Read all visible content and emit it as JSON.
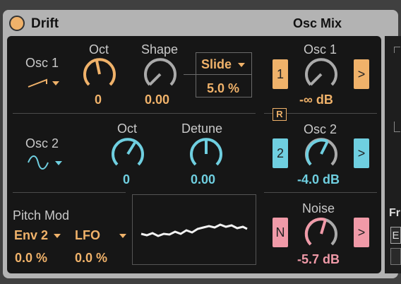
{
  "device": {
    "title": "Drift",
    "section_title": "Osc Mix"
  },
  "osc1": {
    "label": "Osc 1",
    "oct_label": "Oct",
    "oct_value": "0",
    "shape_label": "Shape",
    "shape_value": "0.00",
    "slide_label": "Slide",
    "slide_value": "5.0 %"
  },
  "osc2": {
    "label": "Osc 2",
    "oct_label": "Oct",
    "oct_value": "0",
    "detune_label": "Detune",
    "detune_value": "0.00"
  },
  "mix": {
    "osc1_label": "Osc 1",
    "osc1_button": "1",
    "osc1_value": "-∞ dB",
    "r_button": "R",
    "osc2_label": "Osc 2",
    "osc2_button": "2",
    "osc2_value": "-4.0 dB",
    "noise_label": "Noise",
    "noise_button": "N",
    "noise_value": "-5.7 dB",
    "arrow": ">"
  },
  "pitch_mod": {
    "label": "Pitch Mod",
    "source1": "Env 2",
    "source2": "LFO",
    "value1": "0.0 %",
    "value2": "0.0 %"
  },
  "side": {
    "label": "Fr",
    "button": "E"
  },
  "colors": {
    "orange": "#f0b26a",
    "cyan": "#6fcfe0",
    "pink": "#f09aa8",
    "bg": "#161616"
  }
}
